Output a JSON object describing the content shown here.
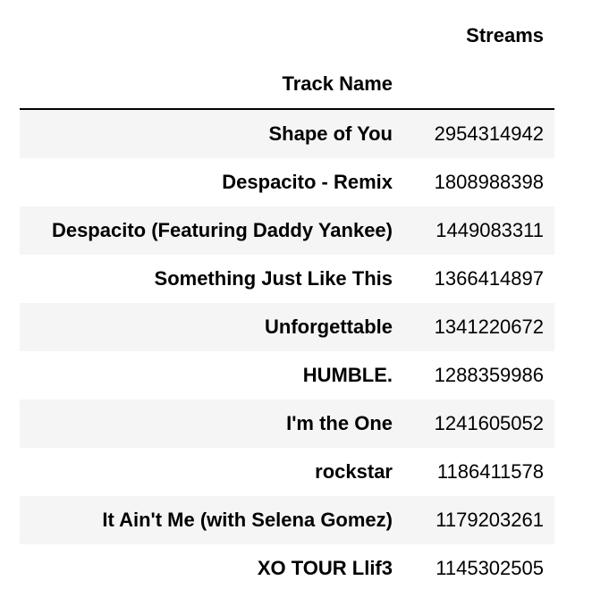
{
  "table": {
    "columns": [
      "Streams"
    ],
    "index_name": "Track Name",
    "rows": [
      {
        "track": "Shape of You",
        "streams": "2954314942"
      },
      {
        "track": "Despacito - Remix",
        "streams": "1808988398"
      },
      {
        "track": "Despacito (Featuring Daddy Yankee)",
        "streams": "1449083311"
      },
      {
        "track": "Something Just Like This",
        "streams": "1366414897"
      },
      {
        "track": "Unforgettable",
        "streams": "1341220672"
      },
      {
        "track": "HUMBLE.",
        "streams": "1288359986"
      },
      {
        "track": "I'm the One",
        "streams": "1241605052"
      },
      {
        "track": "rockstar",
        "streams": "1186411578"
      },
      {
        "track": "It Ain't Me (with Selena Gomez)",
        "streams": "1179203261"
      },
      {
        "track": "XO TOUR Llif3",
        "streams": "1145302505"
      }
    ]
  }
}
